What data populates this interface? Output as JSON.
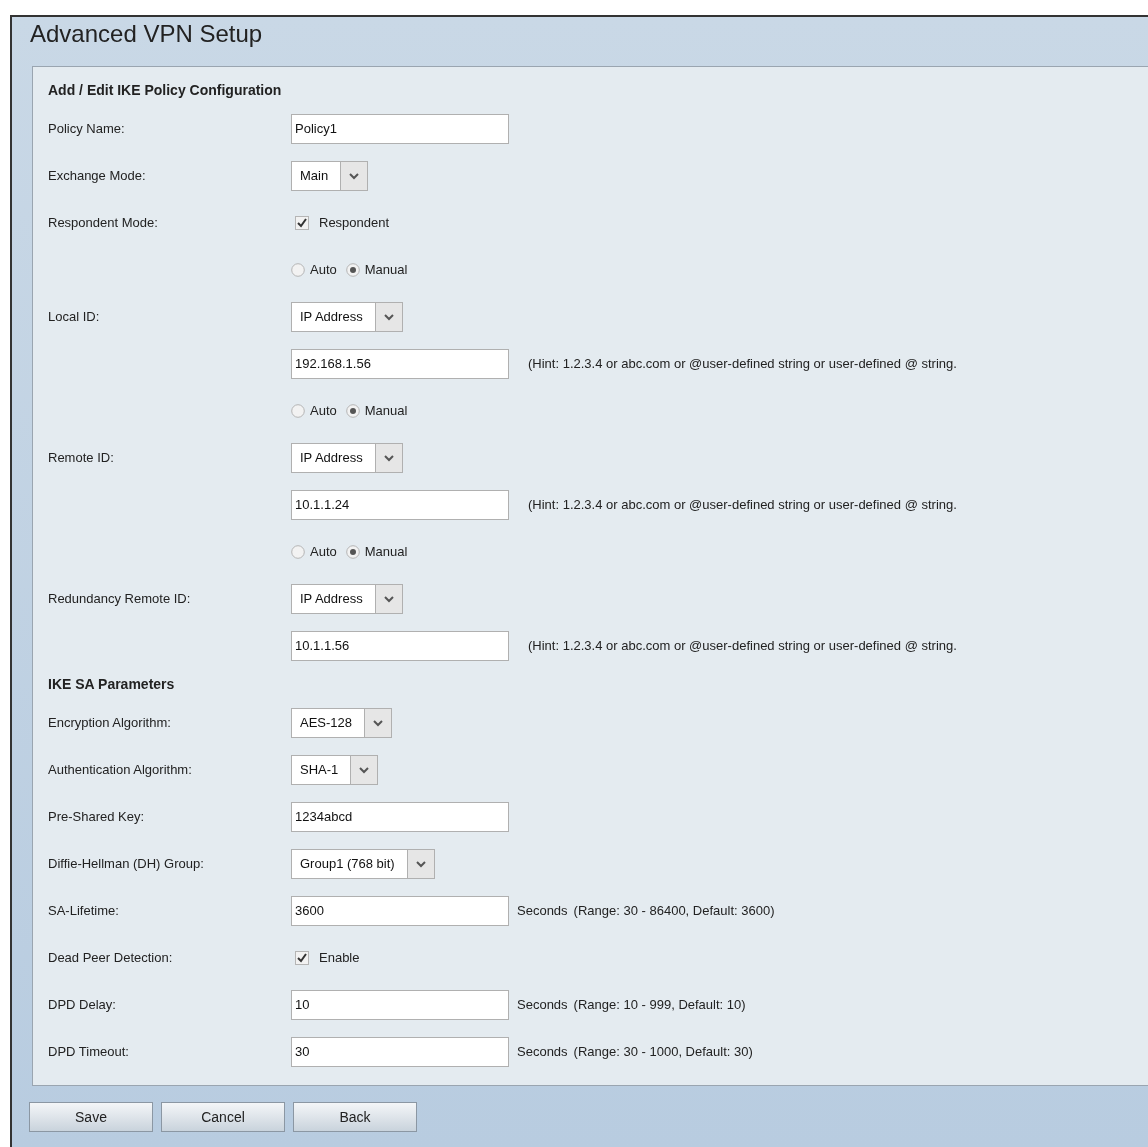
{
  "page_title": "Advanced VPN Setup",
  "sections": [
    {
      "title": "Add / Edit IKE Policy Configuration",
      "rows": [
        {
          "kind": "text",
          "label": "Policy Name:",
          "value": "Policy1"
        },
        {
          "kind": "select",
          "label": "Exchange Mode:",
          "value": "Main"
        },
        {
          "kind": "checkbox",
          "label": "Respondent Mode:",
          "option": "Respondent",
          "checked": true
        },
        {
          "kind": "radio",
          "options": [
            {
              "label": "Auto",
              "selected": false
            },
            {
              "label": "Manual",
              "selected": true
            }
          ]
        },
        {
          "kind": "select",
          "label": "Local ID:",
          "value": "IP Address"
        },
        {
          "kind": "text",
          "value": "192.168.1.56",
          "hint": "(Hint: 1.2.3.4 or abc.com or @user-defined string or user-defined @ string."
        },
        {
          "kind": "radio",
          "options": [
            {
              "label": "Auto",
              "selected": false
            },
            {
              "label": "Manual",
              "selected": true
            }
          ]
        },
        {
          "kind": "select",
          "label": "Remote ID:",
          "value": "IP Address"
        },
        {
          "kind": "text",
          "value": "10.1.1.24",
          "hint": "(Hint: 1.2.3.4 or abc.com or @user-defined string or user-defined @ string."
        },
        {
          "kind": "radio",
          "options": [
            {
              "label": "Auto",
              "selected": false
            },
            {
              "label": "Manual",
              "selected": true
            }
          ]
        },
        {
          "kind": "select",
          "label": "Redundancy Remote ID:",
          "value": "IP Address"
        },
        {
          "kind": "text",
          "value": "10.1.1.56",
          "hint": "(Hint: 1.2.3.4 or abc.com or @user-defined string or user-defined @ string."
        }
      ]
    },
    {
      "title": "IKE SA Parameters",
      "rows": [
        {
          "kind": "select",
          "label": "Encryption Algorithm:",
          "value": "AES-128"
        },
        {
          "kind": "select",
          "label": "Authentication Algorithm:",
          "value": "SHA-1"
        },
        {
          "kind": "text",
          "label": "Pre-Shared Key:",
          "value": "1234abcd"
        },
        {
          "kind": "select",
          "label": "Diffie-Hellman (DH) Group:",
          "value": "Group1 (768 bit)"
        },
        {
          "kind": "text",
          "label": "SA-Lifetime:",
          "value": "3600",
          "unit": "Seconds",
          "hint": "(Range: 30 - 86400, Default: 3600)"
        },
        {
          "kind": "checkbox",
          "label": "Dead Peer Detection:",
          "option": "Enable",
          "checked": true
        },
        {
          "kind": "text",
          "label": "DPD Delay:",
          "value": "10",
          "unit": "Seconds",
          "hint": "(Range: 10 - 999, Default: 10)"
        },
        {
          "kind": "text",
          "label": "DPD Timeout:",
          "value": "30",
          "unit": "Seconds",
          "hint": "(Range: 30 - 1000, Default: 30)"
        }
      ]
    }
  ],
  "buttons": [
    "Save",
    "Cancel",
    "Back"
  ]
}
